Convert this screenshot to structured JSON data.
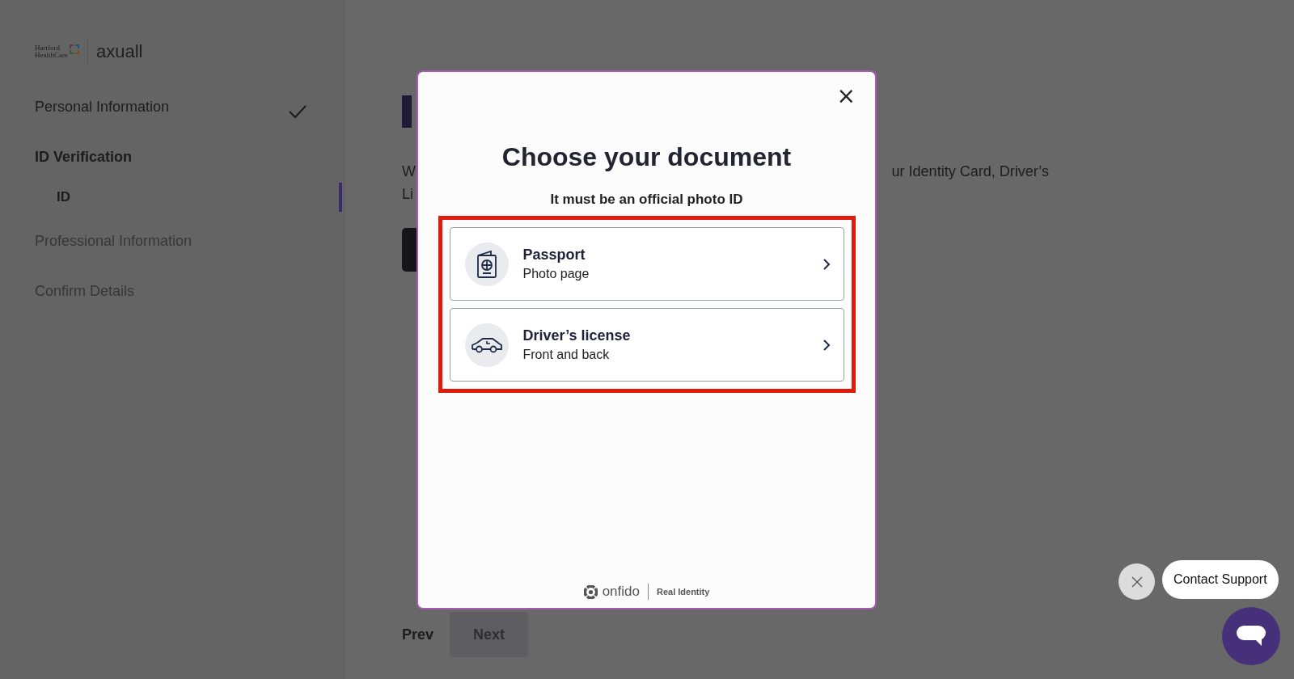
{
  "logo": {
    "org_line_1": "Hartford",
    "org_line_2": "HealthCare",
    "product": "axuall"
  },
  "steps": [
    {
      "label": "Personal Information",
      "completed": true,
      "active": false,
      "disabled": false
    },
    {
      "label": "ID Verification",
      "completed": false,
      "active": true,
      "disabled": false,
      "children": [
        {
          "label": "ID",
          "selected": true
        }
      ]
    },
    {
      "label": "Professional Information",
      "completed": false,
      "active": false,
      "disabled": true
    },
    {
      "label": "Confirm Details",
      "completed": false,
      "active": false,
      "disabled": true
    }
  ],
  "main": {
    "text_left_1": "W",
    "text_left_2": "Li",
    "text_right": "ur Identity Card, Driver’s"
  },
  "nav": {
    "prev": "Prev",
    "next": {
      "label": "Next",
      "disabled": true
    }
  },
  "modal": {
    "close": "×",
    "title": "Choose your document",
    "subtitle": "It must be an official photo ID",
    "highlighted": true,
    "options": [
      {
        "kind": "passport",
        "title": "Passport",
        "subtitle": "Photo page"
      },
      {
        "kind": "car",
        "title": "Driver’s license",
        "subtitle": "Front and back"
      }
    ],
    "footer": {
      "brand": "onfido",
      "tagline": "Real Identity"
    }
  },
  "support": {
    "label": "Contact Support"
  }
}
